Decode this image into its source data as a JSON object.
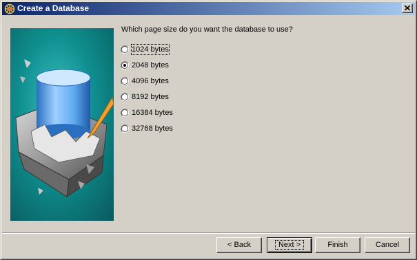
{
  "window": {
    "title": "Create a Database",
    "app_icon": "database-wizard-icon",
    "close_icon": "close-icon"
  },
  "colors": {
    "titlebar_start": "#0a246a",
    "titlebar_end": "#a6caf0",
    "face": "#d4d0c8",
    "illustration_teal": "#0f8f8f"
  },
  "question": "Which page size do you want the database to use?",
  "options": [
    {
      "label": "1024 bytes",
      "selected": false
    },
    {
      "label": "2048 bytes",
      "selected": true
    },
    {
      "label": "4096 bytes",
      "selected": false
    },
    {
      "label": "8192 bytes",
      "selected": false
    },
    {
      "label": "16384 bytes",
      "selected": false
    },
    {
      "label": "32768 bytes",
      "selected": false
    }
  ],
  "buttons": {
    "back": "< Back",
    "next": "Next >",
    "finish": "Finish",
    "cancel": "Cancel"
  }
}
